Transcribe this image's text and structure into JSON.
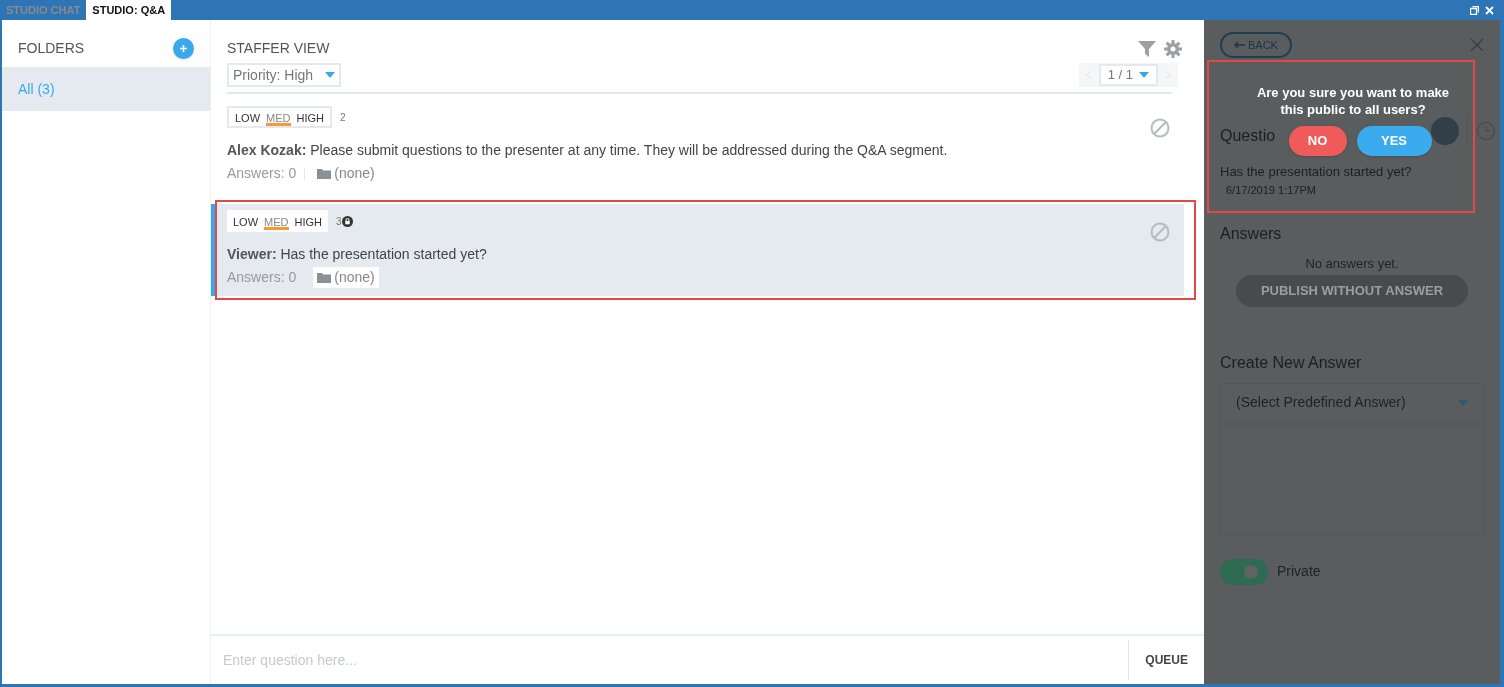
{
  "tabs": [
    {
      "label": "STUDIO CHAT",
      "selected": false
    },
    {
      "label": "STUDIO: Q&A",
      "selected": true
    }
  ],
  "sidebar": {
    "title": "FOLDERS",
    "items": [
      {
        "label": "All (3)",
        "selected": true
      }
    ]
  },
  "main": {
    "title": "STAFFER VIEW",
    "filter": "Priority: High",
    "pager": "1 / 1",
    "questions": [
      {
        "priority": [
          {
            "label": "LOW",
            "selected": false
          },
          {
            "label": "MED",
            "selected": true
          },
          {
            "label": "HIGH",
            "selected": false
          }
        ],
        "count": "2",
        "locked": false,
        "author": "Alex Kozak:",
        "text": "Please submit questions to the presenter at any time. They will be addressed during the Q&A segment.",
        "answers": "Answers: 0",
        "folder": "(none)",
        "selected": false,
        "highlighted": false
      },
      {
        "priority": [
          {
            "label": "LOW",
            "selected": false
          },
          {
            "label": "MED",
            "selected": true
          },
          {
            "label": "HIGH",
            "selected": false
          }
        ],
        "count": "3",
        "locked": true,
        "author": "Viewer:",
        "text": "Has the presentation started yet?",
        "answers": "Answers: 0",
        "folder": "(none)",
        "selected": true,
        "highlighted": true
      }
    ],
    "input": {
      "placeholder": "Enter question here..."
    },
    "queue_button": "QUEUE"
  },
  "detail": {
    "back": "BACK",
    "question_heading": "Questio",
    "question": "Has the presentation started yet?",
    "timestamp": "6/17/2019 1:17PM",
    "answers_heading": "Answers",
    "no_answers": "No answers yet.",
    "publish_button": "PUBLISH WITHOUT ANSWER",
    "create_heading": "Create New Answer",
    "select": {
      "placeholder": "(Select Predefined Answer)"
    },
    "private_toggle": {
      "label": "Private",
      "on": true
    }
  },
  "dialog": {
    "message": "Are you sure you want to make this public to all users?",
    "buttons": [
      {
        "label": "NO",
        "kind": "cancel"
      },
      {
        "label": "YES",
        "kind": "confirm"
      }
    ],
    "highlighted": true
  }
}
